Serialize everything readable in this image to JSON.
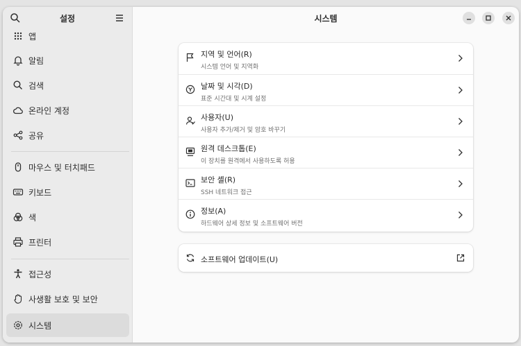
{
  "sidebar": {
    "title": "설정",
    "items": [
      {
        "label": "앱",
        "icon": "apps-grid-icon"
      },
      {
        "label": "알림",
        "icon": "bell-icon"
      },
      {
        "label": "검색",
        "icon": "search-icon"
      },
      {
        "label": "온라인 계정",
        "icon": "cloud-icon"
      },
      {
        "label": "공유",
        "icon": "share-icon"
      },
      {
        "label": "마우스 및 터치패드",
        "icon": "mouse-icon"
      },
      {
        "label": "키보드",
        "icon": "keyboard-icon"
      },
      {
        "label": "색",
        "icon": "color-icon"
      },
      {
        "label": "프린터",
        "icon": "printer-icon"
      },
      {
        "label": "접근성",
        "icon": "accessibility-icon"
      },
      {
        "label": "사생활 보호 및 보안",
        "icon": "privacy-hand-icon"
      },
      {
        "label": "시스템",
        "icon": "gear-icon",
        "active": true
      }
    ]
  },
  "main": {
    "title": "시스템",
    "rows": [
      {
        "title": "지역 및 언어(R)",
        "subtitle": "시스템 언어 및 지역화",
        "icon": "flag-icon"
      },
      {
        "title": "날짜 및 시각(D)",
        "subtitle": "표준 시간대 및 시계 설정",
        "icon": "clock-icon"
      },
      {
        "title": "사용자(U)",
        "subtitle": "사용자 추가/제거 및 암호 바꾸기",
        "icon": "users-icon"
      },
      {
        "title": "원격 데스크톱(E)",
        "subtitle": "이 장치를 원격에서 사용하도록 허용",
        "icon": "remote-desktop-icon"
      },
      {
        "title": "보안 셸(R)",
        "subtitle": "SSH 네트워크 접근",
        "icon": "terminal-icon"
      },
      {
        "title": "정보(A)",
        "subtitle": "하드웨어 상세 정보 및 소프트웨어 버전",
        "icon": "info-icon"
      }
    ],
    "update": {
      "title": "소프트웨어 업데이트(U)",
      "icon": "sync-icon"
    }
  }
}
